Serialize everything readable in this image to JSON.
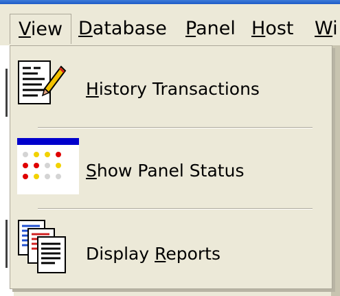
{
  "menubar": {
    "items": [
      {
        "label": "View",
        "underline": "V",
        "rest": "iew"
      },
      {
        "label": "Database",
        "underline": "D",
        "rest": "atabase"
      },
      {
        "label": "Panel",
        "underline": "P",
        "rest": "anel"
      },
      {
        "label": "Host",
        "underline": "H",
        "rest": "ost"
      },
      {
        "label": "Wi",
        "underline": "W",
        "rest": "i"
      }
    ]
  },
  "view_menu": {
    "items": [
      {
        "label": "History Transactions",
        "underline": "H",
        "rest": "istory Transactions",
        "icon": "history-transactions-icon"
      },
      {
        "label": "Show Panel Status",
        "underline": "S",
        "rest": "how Panel Status",
        "icon": "panel-status-icon"
      },
      {
        "label_pre": "Display ",
        "underline": "R",
        "rest": "eports",
        "icon": "display-reports-icon"
      }
    ]
  },
  "colors": {
    "menu_bg": "#ece9d8",
    "border": "#aca899",
    "status_bar_blue": "#0000cc",
    "dot_red": "#e00000",
    "dot_yellow": "#f2d200",
    "dot_gray": "#d4d4d4"
  }
}
